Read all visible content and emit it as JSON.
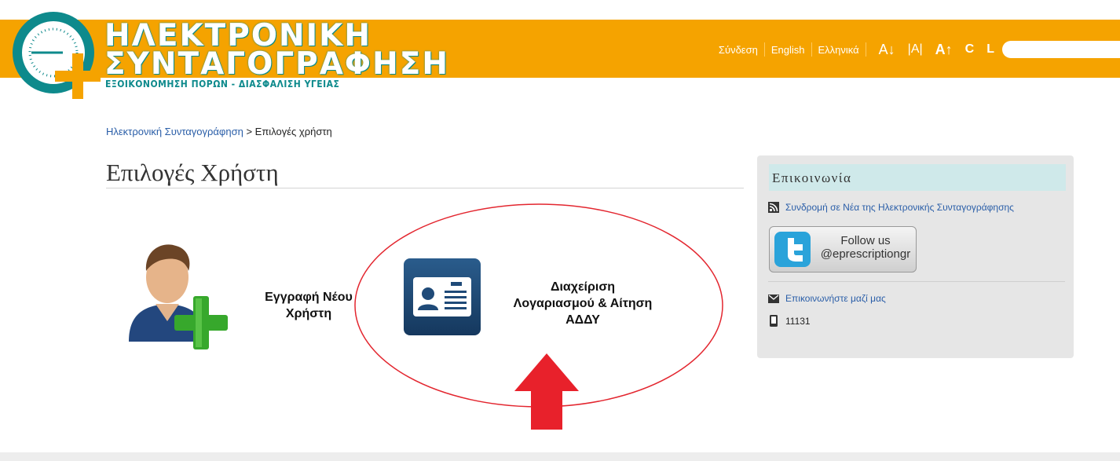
{
  "logo": {
    "title_line1": "ΗΛΕΚΤΡΟΝΙΚΗ",
    "title_line2": "ΣΥΝΤΑΓΟΓΡΑΦΗΣΗ",
    "tagline": "ΕΞΟΙΚΟΝΟΜΗΣΗ ΠΟΡΩΝ - ΔΙΑΣΦΑΛΙΣΗ ΥΓΕΙΑΣ"
  },
  "topnav": {
    "login": "Σύνδεση",
    "english": "English",
    "greek": "Ελληνικά",
    "font_decrease": "A↓",
    "font_reset": "|A|",
    "font_increase": "A↑",
    "contrast": "C",
    "layout": "L",
    "search_placeholder": ""
  },
  "breadcrumb": {
    "home": "Ηλεκτρονική Συνταγογράφηση",
    "separator": " > ",
    "current": "Επιλογές χρήστη"
  },
  "page": {
    "title": "Επιλογές Χρήστη"
  },
  "options": {
    "register_line1": "Εγγραφή Νέου",
    "register_line2": "Χρήστη",
    "account_line1": "Διαχείριση",
    "account_line2": "Λογαριασμού & Αίτηση",
    "account_line3": "ΑΔΔΥ"
  },
  "sidebar": {
    "heading": "Επικοινωνία",
    "news_link": "Συνδρομή σε Νέα της Ηλεκτρονικής Συνταγογράφησης",
    "twitter_line1": "Follow us",
    "twitter_line2": "@eprescriptiongr",
    "contact_link": "Επικοινωνήστε μαζί μας",
    "phone": "11131"
  },
  "colors": {
    "header": "#f5a300",
    "logo_teal": "#0e8a8c",
    "link": "#2a5ea8",
    "annotation": "#e3262f"
  }
}
